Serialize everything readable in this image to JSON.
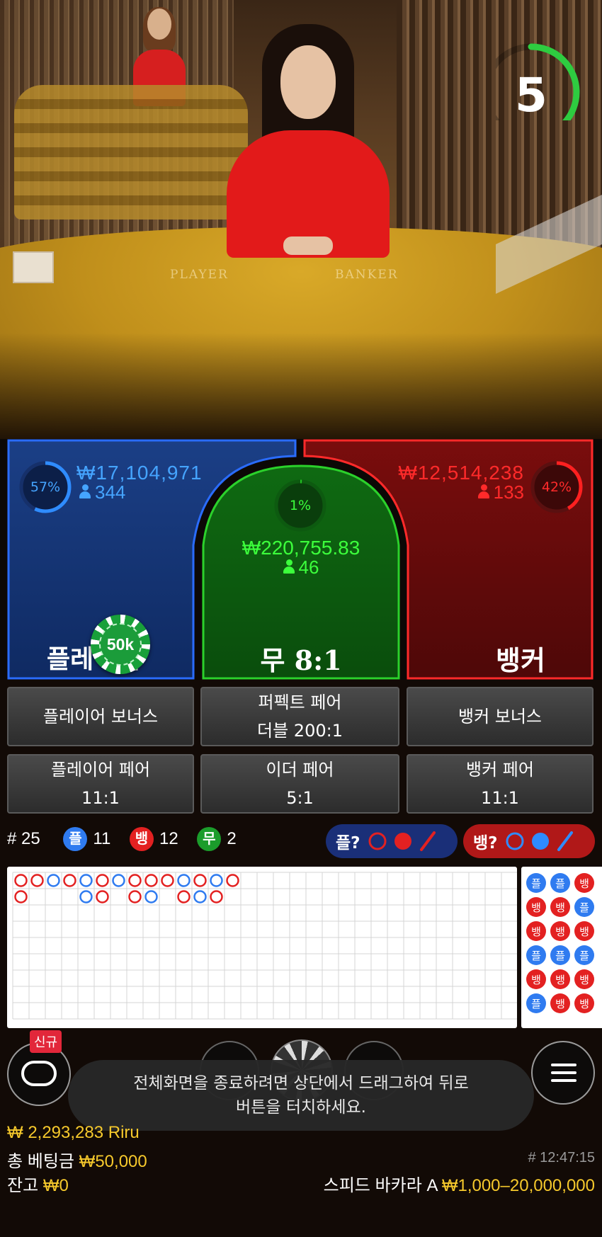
{
  "video": {
    "timer": "5",
    "timer_fraction": 0.6,
    "table_labels": {
      "player": "PLAYER",
      "banker": "BANKER"
    }
  },
  "bets": {
    "player": {
      "pct": "57%",
      "pct_value": 0.57,
      "amount": "₩17,104,971",
      "count": "344",
      "name": "플레이어",
      "color": "#2f8cff"
    },
    "tie": {
      "pct": "1%",
      "pct_value": 0.01,
      "amount": "₩220,755.83",
      "count": "46",
      "name": "무 8:1",
      "color": "#23c223"
    },
    "banker": {
      "pct": "42%",
      "pct_value": 0.42,
      "amount": "₩12,514,238",
      "count": "133",
      "name": "뱅커",
      "color": "#ff2020"
    },
    "chip": "50k"
  },
  "side_bets": [
    {
      "line1": "플레이어 보너스",
      "line2": ""
    },
    {
      "line1": "퍼펙트 페어",
      "line2": "더블 200:1"
    },
    {
      "line1": "뱅커 보너스",
      "line2": ""
    },
    {
      "line1": "플레이어 페어",
      "line2": "11:1"
    },
    {
      "line1": "이더 페어",
      "line2": "5:1"
    },
    {
      "line1": "뱅커 페어",
      "line2": "11:1"
    }
  ],
  "stats": {
    "round": "# 25",
    "player_badge": "플",
    "player_count": "11",
    "banker_badge": "뱅",
    "banker_count": "12",
    "tie_badge": "무",
    "tie_count": "2"
  },
  "ask": {
    "player": "플?",
    "banker": "뱅?"
  },
  "roads": {
    "big_road": [
      [
        "B",
        "B",
        "P",
        "B",
        "P",
        "B",
        "P",
        "B",
        "B",
        "B",
        "P",
        "B",
        "P",
        "B"
      ],
      [
        "B",
        "",
        "",
        "",
        "P",
        "B",
        "",
        "B",
        "P",
        "",
        "B",
        "P",
        "B",
        ""
      ]
    ],
    "side_road": [
      [
        "플",
        "플",
        "뱅"
      ],
      [
        "뱅",
        "뱅",
        "플"
      ],
      [
        "뱅",
        "뱅",
        "뱅"
      ],
      [
        "플",
        "플",
        "플"
      ],
      [
        "뱅",
        "뱅",
        "뱅"
      ],
      [
        "플",
        "뱅",
        "뱅"
      ]
    ]
  },
  "new_badge": "신규",
  "toast": {
    "line1": "전체화면을 종료하려면 상단에서 드래그하여 뒤로",
    "line2": "버튼을 터치하세요."
  },
  "footer": {
    "balance_partial": "₩ 2,293,283 Riru",
    "total_bet_label": "총 베팅금",
    "total_bet_value": "₩50,000",
    "balance_label": "잔고",
    "balance_value": "₩0",
    "round_time": "# 12:47:15",
    "table_name": "스피드 바카라 A",
    "limits": "₩1,000–20,000,000"
  }
}
